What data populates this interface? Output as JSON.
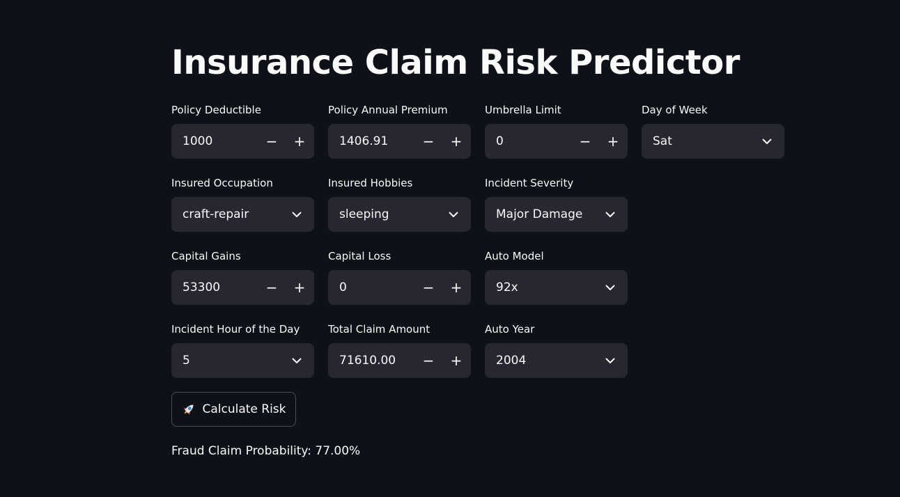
{
  "title": "Insurance Claim Risk Predictor",
  "fields": {
    "policy_deductible": {
      "label": "Policy Deductible",
      "value": "1000"
    },
    "policy_annual_premium": {
      "label": "Policy Annual Premium",
      "value": "1406.91"
    },
    "umbrella_limit": {
      "label": "Umbrella Limit",
      "value": "0"
    },
    "day_of_week": {
      "label": "Day of Week",
      "value": "Sat"
    },
    "insured_occupation": {
      "label": "Insured Occupation",
      "value": "craft-repair"
    },
    "insured_hobbies": {
      "label": "Insured Hobbies",
      "value": "sleeping"
    },
    "incident_severity": {
      "label": "Incident Severity",
      "value": "Major Damage"
    },
    "capital_gains": {
      "label": "Capital Gains",
      "value": "53300"
    },
    "capital_loss": {
      "label": "Capital Loss",
      "value": "0"
    },
    "auto_model": {
      "label": "Auto Model",
      "value": "92x"
    },
    "incident_hour": {
      "label": "Incident Hour of the Day",
      "value": "5"
    },
    "total_claim_amount": {
      "label": "Total Claim Amount",
      "value": "71610.00"
    },
    "auto_year": {
      "label": "Auto Year",
      "value": "2004"
    }
  },
  "stepper": {
    "minus": "−",
    "plus": "+"
  },
  "calculate_button": {
    "label": "Calculate Risk",
    "icon": "rocket-icon"
  },
  "result_text": "Fraud Claim Probability: 77.00%",
  "colors": {
    "background": "#0e1117",
    "input_bg": "#262730",
    "text": "#fafafa",
    "button_border": "#4a4d58"
  }
}
